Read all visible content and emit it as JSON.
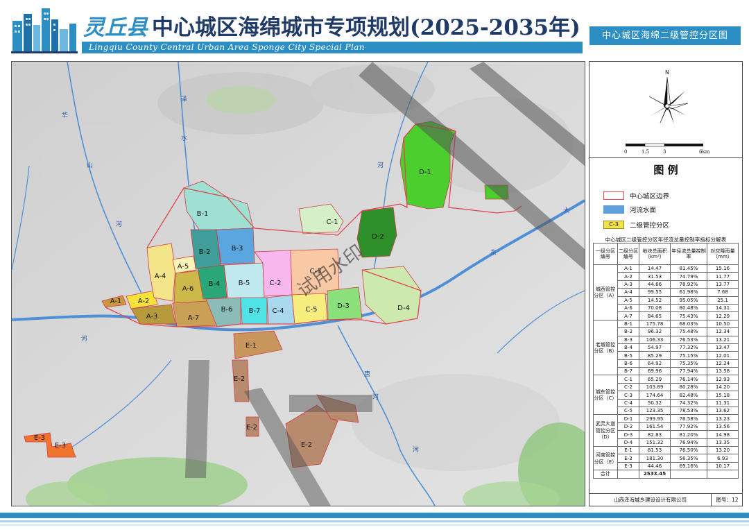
{
  "header": {
    "county": "灵丘县",
    "title": "中心城区海绵城市专项规划(2025-2035年)",
    "subtitle_en": "Lingqiu County Central Urban Area Sponge City Special Plan",
    "map_name": "中心城区海绵二级管控分区图"
  },
  "compass": {
    "north": "N",
    "scale_labels": [
      "0",
      "1.5",
      "3",
      "6km"
    ]
  },
  "legend": {
    "title": "图 例",
    "items": [
      {
        "label": "中心城区边界",
        "swatch_color": "#ffffff",
        "border_color": "#e0454d"
      },
      {
        "label": "河流水面",
        "swatch_color": "#5f9fdc",
        "border_color": "#5f9fdc"
      },
      {
        "label": "二级管控分区",
        "swatch_color": "#f3e34a",
        "border_color": "#9a8a20",
        "swatch_text": "C-3"
      }
    ]
  },
  "table": {
    "title": "中心城区二级管控分区年径流总量控制率指标分解表",
    "headers": [
      "一级分区编号",
      "二级分区编号",
      "地块总面积（km²）",
      "年径流总量控制率",
      "对应降雨量（mm）"
    ],
    "groups": [
      {
        "name": "城西管控分区（A）",
        "rows": [
          [
            "A-1",
            "14.47",
            "81.45%",
            "15.16"
          ],
          [
            "A-2",
            "31.53",
            "74.79%",
            "11.77"
          ],
          [
            "A-3",
            "44.66",
            "78.92%",
            "13.77"
          ],
          [
            "A-4",
            "99.55",
            "61.98%",
            "7.68"
          ],
          [
            "A-5",
            "14.52",
            "95.05%",
            "25.1"
          ],
          [
            "A-6",
            "70.08",
            "80.48%",
            "14.31"
          ],
          [
            "A-7",
            "84.65",
            "75.43%",
            "12.29"
          ]
        ]
      },
      {
        "name": "老城管控分区（B）",
        "rows": [
          [
            "B-1",
            "175.78",
            "68.03%",
            "10.50"
          ],
          [
            "B-2",
            "96.32",
            "75.48%",
            "12.34"
          ],
          [
            "B-3",
            "106.33",
            "76.53%",
            "13.21"
          ],
          [
            "B-4",
            "54.97",
            "77.32%",
            "13.47"
          ],
          [
            "B-5",
            "85.29",
            "75.15%",
            "12.01"
          ],
          [
            "B-6",
            "64.92",
            "75.35%",
            "12.24"
          ],
          [
            "B-7",
            "69.96",
            "77.94%",
            "13.58"
          ]
        ]
      },
      {
        "name": "城东管控分区（C）",
        "rows": [
          [
            "C-1",
            "65.29",
            "76.14%",
            "12.93"
          ],
          [
            "C-2",
            "103.89",
            "80.28%",
            "14.20"
          ],
          [
            "C-3",
            "174.64",
            "82.48%",
            "15.18"
          ],
          [
            "C-4",
            "50.32",
            "74.32%",
            "11.31"
          ],
          [
            "C-5",
            "123.35",
            "78.53%",
            "13.62"
          ]
        ]
      },
      {
        "name": "武灵大道管控分区（D）",
        "rows": [
          [
            "D-1",
            "299.95",
            "76.58%",
            "13.23"
          ],
          [
            "D-2",
            "161.54",
            "77.92%",
            "13.56"
          ],
          [
            "D-3",
            "82.83",
            "81.20%",
            "14.98"
          ],
          [
            "D-4",
            "151.32",
            "76.94%",
            "13.35"
          ]
        ]
      },
      {
        "name": "河南管控分区（E）",
        "rows": [
          [
            "E-1",
            "81.53",
            "76.50%",
            "13.20"
          ],
          [
            "E-2",
            "181.30",
            "56.35%",
            "6.93"
          ],
          [
            "E-3",
            "44.46",
            "69.16%",
            "10.17"
          ]
        ]
      }
    ],
    "total_label": "合计",
    "total_value": "2533.45"
  },
  "footer": {
    "company": "山西泽海城乡建设设计有限公司",
    "figure_no": "图号：12"
  },
  "map": {
    "rivers": [
      "华",
      "山",
      "河",
      "泽",
      "水",
      "河",
      "河",
      "唐",
      "河",
      "河",
      "大",
      "东"
    ],
    "zones": [
      {
        "id": "A-1",
        "color": "#c9973c"
      },
      {
        "id": "A-2",
        "color": "#f5e23a"
      },
      {
        "id": "A-3",
        "color": "#b79a3c"
      },
      {
        "id": "A-4",
        "color": "#f5e58a"
      },
      {
        "id": "A-5",
        "color": "#fbf3b8"
      },
      {
        "id": "A-6",
        "color": "#cdb84a"
      },
      {
        "id": "A-7",
        "color": "#c9a055"
      },
      {
        "id": "B-1",
        "color": "#9fe0d2"
      },
      {
        "id": "B-2",
        "color": "#3f9e98"
      },
      {
        "id": "B-3",
        "color": "#5aa7e0"
      },
      {
        "id": "B-4",
        "color": "#29a778"
      },
      {
        "id": "B-5",
        "color": "#bfe9ef"
      },
      {
        "id": "B-6",
        "color": "#8bbcb8"
      },
      {
        "id": "B-7",
        "color": "#4fe3e8"
      },
      {
        "id": "C-1",
        "color": "#d5f0c8"
      },
      {
        "id": "C-2",
        "color": "#f6b8ef"
      },
      {
        "id": "C-3",
        "color": "#f9c9a6"
      },
      {
        "id": "C-4",
        "color": "#a9d7ee"
      },
      {
        "id": "C-5",
        "color": "#f5ee7e"
      },
      {
        "id": "D-1",
        "color": "#4ccf2e"
      },
      {
        "id": "D-2",
        "color": "#2f8f2a"
      },
      {
        "id": "D-3",
        "color": "#8be07b"
      },
      {
        "id": "D-4",
        "color": "#cde9ad"
      },
      {
        "id": "E-1",
        "color": "#c8965c"
      },
      {
        "id": "E-2",
        "color": "#b98b6e"
      },
      {
        "id": "E-3",
        "color": "#f0742e"
      }
    ],
    "watermark": "试用水印"
  }
}
